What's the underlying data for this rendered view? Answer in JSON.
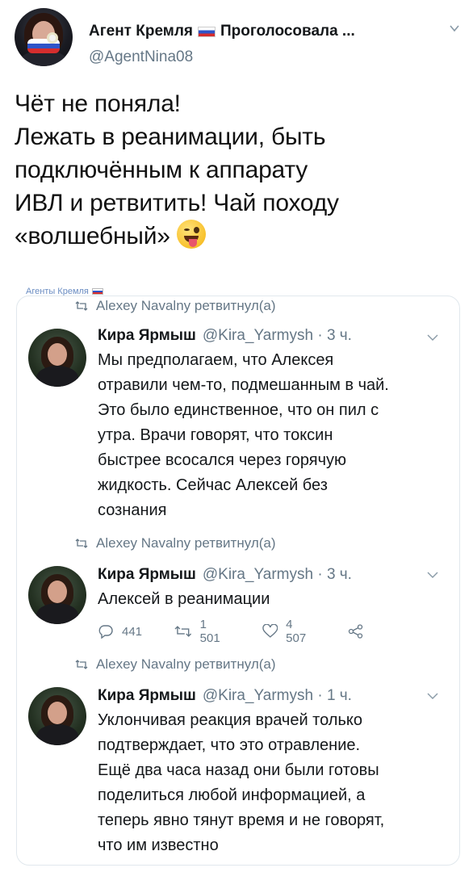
{
  "header": {
    "display_name": "Агент Кремля",
    "display_name_tail": "Проголосовала ...",
    "handle": "@AgentNina08"
  },
  "tweet": {
    "lines": [
      "Чёт не поняла!",
      "Лежать в реанимации, быть",
      "подключённым к аппарату",
      "ИВЛ и ретвитить! Чай походу",
      "«волшебный»"
    ],
    "emoji": "winking-face-with-tongue"
  },
  "watermark": {
    "text": "Агенты Кремля"
  },
  "embedded": {
    "items": [
      {
        "retweet_label": "Alexey Navalny ретвитнул(а)",
        "name": "Кира Ярмыш",
        "handle_time": "@Kira_Yarmysh · 3 ч.",
        "text_lines": [
          "Мы предполагаем, что Алексея",
          "отравили чем-то, подмешанным в чай.",
          "Это было единственное, что он пил с",
          "утра. Врачи говорят, что токсин",
          "быстрее всосался через горячую",
          "жидкость. Сейчас Алексей без",
          "сознания"
        ]
      },
      {
        "retweet_label": "Alexey Navalny ретвитнул(а)",
        "name": "Кира Ярмыш",
        "handle_time": "@Kira_Yarmysh · 3 ч.",
        "text_lines": [
          "Алексей в реанимации"
        ],
        "actions": {
          "replies": "441",
          "retweets": "1 501",
          "likes": "4 507"
        }
      },
      {
        "retweet_label": "Alexey Navalny ретвитнул(а)",
        "name": "Кира Ярмыш",
        "handle_time": "@Kira_Yarmysh · 1 ч.",
        "text_lines": [
          "Уклончивая реакция врачей только",
          "подтверждает, что это отравление.",
          "Ещё два часа назад они были готовы",
          "поделиться любой информацией, а",
          "теперь явно тянут время и не говорят,",
          "что им известно"
        ]
      }
    ]
  },
  "colors": {
    "text": "#14171a",
    "secondary": "#657786",
    "border": "#e1e8ed",
    "watermark": "#6c8ec3"
  }
}
